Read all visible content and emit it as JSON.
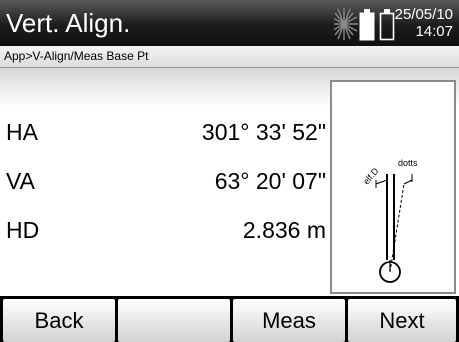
{
  "header": {
    "title": "Vert. Align.",
    "date": "25/05/10",
    "time": "14:07",
    "icons": [
      "laser-starburst-icon",
      "battery-left-icon",
      "battery-right-icon"
    ]
  },
  "breadcrumb": "App>V-Align/Meas Base Pt",
  "measurements": [
    {
      "label": "HA",
      "value": "301° 33' 52\""
    },
    {
      "label": "VA",
      "value": "63° 20' 07\""
    },
    {
      "label": "HD",
      "value": "2.836 m"
    }
  ],
  "diagram": {
    "label_left": "elf.D",
    "label_right": "dotts"
  },
  "softkeys": {
    "back": "Back",
    "empty": "",
    "meas": "Meas",
    "next": "Next"
  }
}
